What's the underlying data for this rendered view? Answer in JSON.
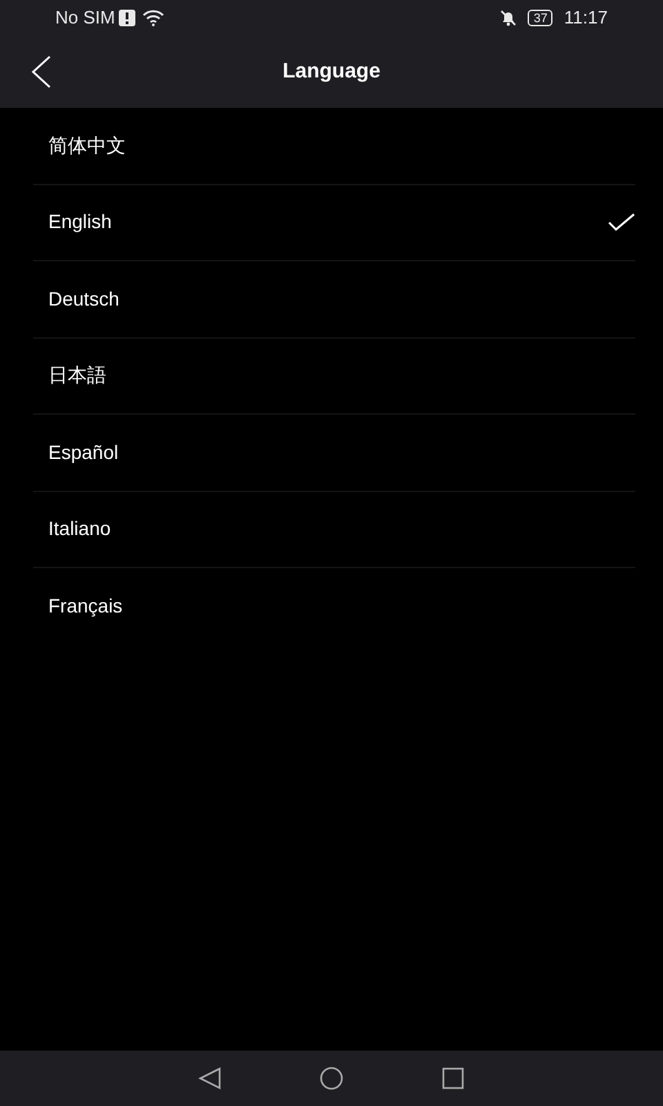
{
  "status_bar": {
    "carrier": "No SIM",
    "battery": "37",
    "time": "11:17"
  },
  "header": {
    "title": "Language"
  },
  "languages": [
    {
      "label": "简体中文",
      "selected": false
    },
    {
      "label": "English",
      "selected": true
    },
    {
      "label": "Deutsch",
      "selected": false
    },
    {
      "label": "日本語",
      "selected": false
    },
    {
      "label": "Español",
      "selected": false
    },
    {
      "label": "Italiano",
      "selected": false
    },
    {
      "label": "Français",
      "selected": false
    }
  ]
}
